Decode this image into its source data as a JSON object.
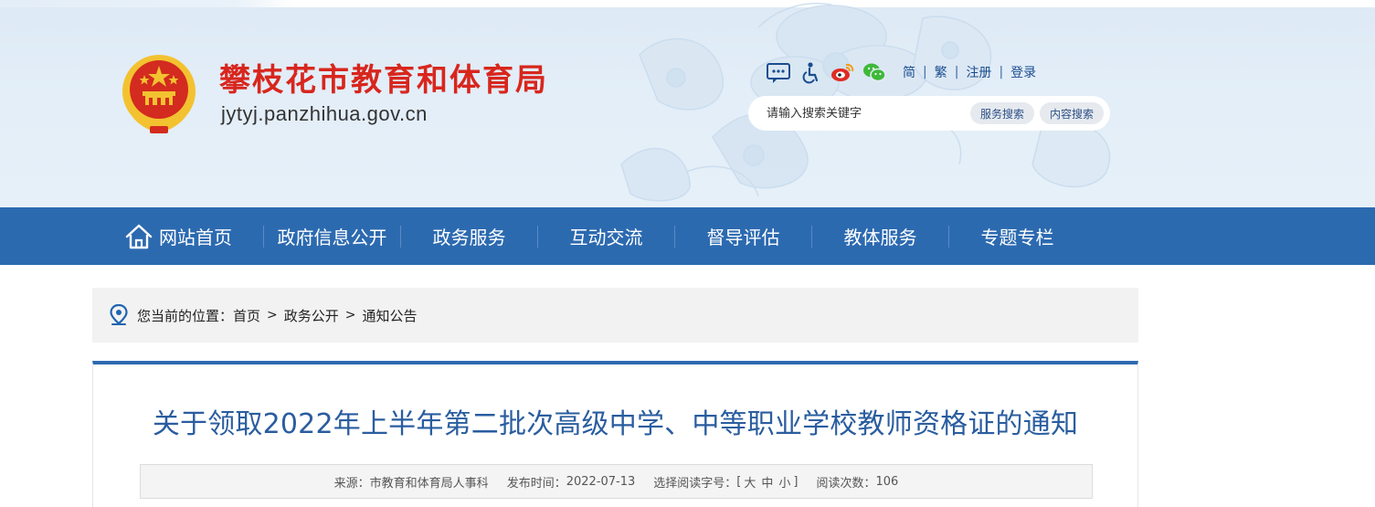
{
  "header": {
    "site_title": "攀枝花市教育和体育局",
    "site_domain": "jytyj.panzhihua.gov.cn",
    "tools": {
      "icons": [
        "message-icon",
        "accessibility-icon",
        "weibo-icon",
        "wechat-icon"
      ],
      "simplified": "简",
      "traditional": "繁",
      "register": "注册",
      "login": "登录",
      "separator": "|"
    },
    "search": {
      "placeholder": "请输入搜索关键字",
      "service_button": "服务搜索",
      "content_button": "内容搜索"
    },
    "colors": {
      "title_red": "#d8261d",
      "emblem_red": "#d32b1f",
      "emblem_gold": "#f2c230",
      "bg_blue": "#e3eef8"
    }
  },
  "nav": {
    "items": [
      {
        "label": "网站首页",
        "icon": "home-icon"
      },
      {
        "label": "政府信息公开"
      },
      {
        "label": "政务服务"
      },
      {
        "label": "互动交流"
      },
      {
        "label": "督导评估"
      },
      {
        "label": "教体服务"
      },
      {
        "label": "专题专栏"
      }
    ],
    "color": "#2c6ab0"
  },
  "breadcrumb": {
    "icon": "location-pin-icon",
    "prefix": "您当前的位置：",
    "items": [
      "首页",
      "政务公开",
      "通知公告"
    ],
    "separator": ">"
  },
  "article": {
    "title": "关于领取2022年上半年第二批次高级中学、中等职业学校教师资格证的通知",
    "meta": {
      "source_label": "来源：",
      "source": "市教育和体育局人事科",
      "date_label": "发布时间：",
      "date": "2022-07-13",
      "font_label": "选择阅读字号：",
      "bracket_open": "[",
      "bracket_close": "]",
      "font_large": "大",
      "font_medium": "中",
      "font_small": "小",
      "views_label": "阅读次数：",
      "views": "106"
    },
    "accent_color": "#2c6ab0",
    "title_color": "#2a5d9f"
  }
}
